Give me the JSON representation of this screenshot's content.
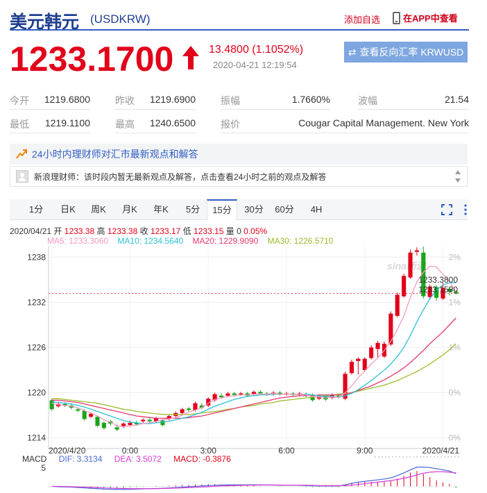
{
  "header": {
    "name": "美元韩元",
    "code": "(USDKRW)",
    "add_fav": "添加自选",
    "app_view": "在APP中查看"
  },
  "quote": {
    "price": "1233.1700",
    "change": "13.4800 (1.1052%)",
    "time": "2020-04-21 12:19:54",
    "reverse_label": "查看反向汇率 KRWUSD"
  },
  "stats": {
    "open_label": "今开",
    "open": "1219.6800",
    "prev_close_label": "昨收",
    "prev_close": "1219.6900",
    "amplitude_label": "振幅",
    "amplitude": "1.7660%",
    "wave_label": "波幅",
    "wave": "21.54",
    "low_label": "最低",
    "low": "1219.1100",
    "high_label": "最高",
    "high": "1240.6500",
    "quote_label": "报价",
    "quote": "Cougar Capital Management. New York"
  },
  "opinion": {
    "head": "24小时内理财师对汇市最新观点和解答",
    "body": "新浪理财师：该时段内暂无最新观点及解答，点击查看24小时之前的观点及解答"
  },
  "tabs": [
    "1分",
    "日K",
    "周K",
    "月K",
    "年K",
    "5分",
    "15分",
    "30分",
    "60分",
    "4H"
  ],
  "active_tab": "15分",
  "ohlc": {
    "date": "2020/04/21",
    "open_label": "开",
    "open": "1233.38",
    "high_label": "高",
    "high": "1233.38",
    "close_label": "收",
    "close": "1233.17",
    "low_label": "低",
    "low": "1233.15",
    "vol_label": "量",
    "vol": "0",
    "pct": "0.05%"
  },
  "ma": {
    "ma5": "MA5: 1233.3060",
    "ma10": "MA10: 1234.5640",
    "ma20": "MA20: 1229.9090",
    "ma30": "MA30: 1226.5710"
  },
  "macd": {
    "label": "MACD",
    "dif": "DIF: 3.3134",
    "dea": "DEA: 3.5072",
    "macd": "MACD: -0.3876",
    "axis_top": "5"
  },
  "colors": {
    "up": "#e2001a",
    "down": "#1aa51a",
    "ma5": "#f29ac0",
    "ma10": "#2ec0d8",
    "ma20": "#e8386d",
    "ma30": "#9cbd2a"
  },
  "chart_data": {
    "type": "candlestick",
    "y_ticks": [
      "1238",
      "1232",
      "1226",
      "1220",
      "1214"
    ],
    "y_tick_values": [
      1238,
      1232,
      1226,
      1220,
      1214
    ],
    "pct_ticks": [
      "2%",
      "1%",
      "1%",
      "0%",
      "0%"
    ],
    "ylim": [
      1213.5,
      1239.5
    ],
    "x_ticks": [
      "2020/4/20",
      "0:00",
      "3:00",
      "6:00",
      "9:00",
      "2020/4/21"
    ],
    "x_tick_index": [
      0,
      12,
      24,
      36,
      48,
      60
    ],
    "last_price_labels": [
      "1233.3800",
      "1233.1590"
    ],
    "watermark": "sina新浪",
    "candles": [
      {
        "o": 1219.0,
        "c": 1217.8,
        "h": 1219.2,
        "l": 1217.6
      },
      {
        "o": 1218.2,
        "c": 1218.5,
        "h": 1218.8,
        "l": 1218.0
      },
      {
        "o": 1218.5,
        "c": 1218.3,
        "h": 1218.7,
        "l": 1218.1
      },
      {
        "o": 1218.3,
        "c": 1218.0,
        "h": 1218.6,
        "l": 1217.8
      },
      {
        "o": 1217.8,
        "c": 1217.6,
        "h": 1218.0,
        "l": 1217.4
      },
      {
        "o": 1217.6,
        "c": 1216.5,
        "h": 1217.8,
        "l": 1216.3
      },
      {
        "o": 1216.8,
        "c": 1217.2,
        "h": 1217.4,
        "l": 1216.6
      },
      {
        "o": 1216.8,
        "c": 1215.6,
        "h": 1217.0,
        "l": 1215.4
      },
      {
        "o": 1216.0,
        "c": 1215.3,
        "h": 1216.2,
        "l": 1215.1
      },
      {
        "o": 1216.2,
        "c": 1215.9,
        "h": 1216.4,
        "l": 1215.6
      },
      {
        "o": 1215.4,
        "c": 1215.1,
        "h": 1215.8,
        "l": 1214.9
      },
      {
        "o": 1215.5,
        "c": 1215.9,
        "h": 1216.1,
        "l": 1215.3
      },
      {
        "o": 1215.7,
        "c": 1216.0,
        "h": 1216.3,
        "l": 1215.5
      },
      {
        "o": 1216.0,
        "c": 1215.8,
        "h": 1216.3,
        "l": 1215.6
      },
      {
        "o": 1216.2,
        "c": 1216.4,
        "h": 1216.6,
        "l": 1216.0
      },
      {
        "o": 1216.4,
        "c": 1216.2,
        "h": 1216.6,
        "l": 1216.0
      },
      {
        "o": 1216.2,
        "c": 1216.6,
        "h": 1216.8,
        "l": 1216.0
      },
      {
        "o": 1216.3,
        "c": 1215.7,
        "h": 1216.5,
        "l": 1215.5
      },
      {
        "o": 1216.5,
        "c": 1216.9,
        "h": 1217.1,
        "l": 1216.3
      },
      {
        "o": 1216.9,
        "c": 1217.3,
        "h": 1217.5,
        "l": 1216.7
      },
      {
        "o": 1217.3,
        "c": 1217.8,
        "h": 1218.0,
        "l": 1217.1
      },
      {
        "o": 1217.9,
        "c": 1217.7,
        "h": 1218.1,
        "l": 1217.5
      },
      {
        "o": 1217.7,
        "c": 1218.6,
        "h": 1218.8,
        "l": 1217.5
      },
      {
        "o": 1218.3,
        "c": 1218.0,
        "h": 1218.6,
        "l": 1217.8
      },
      {
        "o": 1218.3,
        "c": 1219.2,
        "h": 1219.4,
        "l": 1218.1
      },
      {
        "o": 1219.0,
        "c": 1219.8,
        "h": 1220.0,
        "l": 1218.8
      },
      {
        "o": 1219.6,
        "c": 1219.4,
        "h": 1219.9,
        "l": 1219.2
      },
      {
        "o": 1219.6,
        "c": 1219.9,
        "h": 1220.1,
        "l": 1219.4
      },
      {
        "o": 1219.9,
        "c": 1219.7,
        "h": 1220.1,
        "l": 1219.5
      },
      {
        "o": 1219.8,
        "c": 1219.9,
        "h": 1220.1,
        "l": 1219.6
      },
      {
        "o": 1219.9,
        "c": 1219.6,
        "h": 1220.1,
        "l": 1219.4
      },
      {
        "o": 1219.8,
        "c": 1220.1,
        "h": 1220.3,
        "l": 1219.6
      },
      {
        "o": 1220.1,
        "c": 1219.9,
        "h": 1220.3,
        "l": 1219.7
      },
      {
        "o": 1219.9,
        "c": 1219.8,
        "h": 1220.1,
        "l": 1219.6
      },
      {
        "o": 1219.8,
        "c": 1220.0,
        "h": 1220.2,
        "l": 1219.6
      },
      {
        "o": 1220.0,
        "c": 1219.8,
        "h": 1220.2,
        "l": 1219.6
      },
      {
        "o": 1219.8,
        "c": 1219.9,
        "h": 1220.1,
        "l": 1219.6
      },
      {
        "o": 1219.9,
        "c": 1219.7,
        "h": 1220.1,
        "l": 1219.5
      },
      {
        "o": 1219.7,
        "c": 1219.9,
        "h": 1220.1,
        "l": 1219.5
      },
      {
        "o": 1219.8,
        "c": 1219.6,
        "h": 1220.0,
        "l": 1219.4
      },
      {
        "o": 1219.7,
        "c": 1219.0,
        "h": 1219.9,
        "l": 1218.8
      },
      {
        "o": 1219.2,
        "c": 1219.6,
        "h": 1219.8,
        "l": 1219.0
      },
      {
        "o": 1219.5,
        "c": 1219.1,
        "h": 1219.7,
        "l": 1218.9
      },
      {
        "o": 1219.3,
        "c": 1219.7,
        "h": 1219.9,
        "l": 1219.1
      },
      {
        "o": 1219.6,
        "c": 1219.4,
        "h": 1219.8,
        "l": 1219.2
      },
      {
        "o": 1219.2,
        "c": 1222.5,
        "h": 1222.8,
        "l": 1219.0
      },
      {
        "o": 1222.6,
        "c": 1224.1,
        "h": 1224.4,
        "l": 1222.4
      },
      {
        "o": 1224.2,
        "c": 1224.5,
        "h": 1224.7,
        "l": 1222.4
      },
      {
        "o": 1223.0,
        "c": 1224.5,
        "h": 1224.7,
        "l": 1222.8
      },
      {
        "o": 1224.6,
        "c": 1226.0,
        "h": 1226.3,
        "l": 1224.4
      },
      {
        "o": 1225.8,
        "c": 1226.6,
        "h": 1226.9,
        "l": 1224.6
      },
      {
        "o": 1224.8,
        "c": 1226.5,
        "h": 1226.8,
        "l": 1224.6
      },
      {
        "o": 1226.4,
        "c": 1230.5,
        "h": 1230.8,
        "l": 1226.2
      },
      {
        "o": 1230.2,
        "c": 1233.0,
        "h": 1233.3,
        "l": 1230.0
      },
      {
        "o": 1232.8,
        "c": 1235.5,
        "h": 1235.8,
        "l": 1232.6
      },
      {
        "o": 1235.3,
        "c": 1238.6,
        "h": 1239.0,
        "l": 1235.1
      },
      {
        "o": 1238.7,
        "c": 1238.9,
        "h": 1239.3,
        "l": 1238.2
      },
      {
        "o": 1238.6,
        "c": 1232.8,
        "h": 1239.4,
        "l": 1232.5
      },
      {
        "o": 1232.7,
        "c": 1234.1,
        "h": 1234.4,
        "l": 1232.4
      },
      {
        "o": 1234.0,
        "c": 1232.6,
        "h": 1234.3,
        "l": 1232.2
      },
      {
        "o": 1232.5,
        "c": 1233.9,
        "h": 1234.6,
        "l": 1232.3
      },
      {
        "o": 1233.8,
        "c": 1233.4,
        "h": 1234.1,
        "l": 1232.9
      },
      {
        "o": 1233.4,
        "c": 1233.17,
        "h": 1233.6,
        "l": 1233.0
      }
    ],
    "ma5": [
      1218.6,
      1218.4,
      1218.3,
      1218.2,
      1218.0,
      1217.6,
      1217.3,
      1216.9,
      1216.4,
      1216.1,
      1215.6,
      1215.5,
      1215.6,
      1215.7,
      1215.9,
      1216.0,
      1216.2,
      1216.4,
      1216.5,
      1216.7,
      1217.0,
      1217.4,
      1217.7,
      1218.0,
      1218.6,
      1219.1,
      1219.3,
      1219.5,
      1219.6,
      1219.7,
      1219.7,
      1219.8,
      1219.8,
      1219.8,
      1219.9,
      1219.8,
      1219.8,
      1219.8,
      1219.8,
      1219.7,
      1219.5,
      1219.4,
      1219.3,
      1219.4,
      1219.4,
      1220.0,
      1220.9,
      1222.0,
      1222.9,
      1223.8,
      1224.6,
      1225.6,
      1226.8,
      1228.4,
      1230.2,
      1232.6,
      1234.7,
      1236.0,
      1236.8,
      1236.7,
      1235.7,
      1234.8,
      1233.3
    ],
    "ma10": [
      1218.8,
      1218.7,
      1218.6,
      1218.5,
      1218.3,
      1218.1,
      1217.8,
      1217.5,
      1217.2,
      1216.9,
      1216.6,
      1216.3,
      1216.1,
      1216.0,
      1215.9,
      1215.9,
      1216.0,
      1216.1,
      1216.2,
      1216.4,
      1216.6,
      1216.8,
      1217.1,
      1217.4,
      1217.8,
      1218.2,
      1218.5,
      1218.8,
      1219.1,
      1219.3,
      1219.5,
      1219.6,
      1219.7,
      1219.7,
      1219.8,
      1219.8,
      1219.8,
      1219.8,
      1219.8,
      1219.8,
      1219.7,
      1219.6,
      1219.5,
      1219.5,
      1219.4,
      1219.6,
      1219.9,
      1220.4,
      1221.0,
      1221.6,
      1222.3,
      1223.0,
      1223.8,
      1224.8,
      1226.0,
      1227.6,
      1229.4,
      1231.0,
      1232.5,
      1233.6,
      1234.3,
      1234.6,
      1234.6
    ],
    "ma20": [
      1219.0,
      1219.0,
      1218.9,
      1218.8,
      1218.7,
      1218.5,
      1218.3,
      1218.1,
      1217.9,
      1217.7,
      1217.5,
      1217.3,
      1217.1,
      1216.9,
      1216.8,
      1216.7,
      1216.6,
      1216.6,
      1216.6,
      1216.6,
      1216.6,
      1216.7,
      1216.8,
      1216.9,
      1217.1,
      1217.3,
      1217.5,
      1217.7,
      1217.9,
      1218.1,
      1218.3,
      1218.5,
      1218.7,
      1218.9,
      1219.1,
      1219.3,
      1219.4,
      1219.5,
      1219.6,
      1219.6,
      1219.6,
      1219.7,
      1219.7,
      1219.7,
      1219.7,
      1219.8,
      1220.0,
      1220.3,
      1220.6,
      1220.9,
      1221.3,
      1221.7,
      1222.2,
      1222.7,
      1223.3,
      1224.0,
      1224.8,
      1225.6,
      1226.5,
      1227.3,
      1228.1,
      1229.0,
      1229.9
    ],
    "ma30": [
      1219.2,
      1219.2,
      1219.1,
      1219.0,
      1218.9,
      1218.8,
      1218.7,
      1218.6,
      1218.4,
      1218.2,
      1218.0,
      1217.8,
      1217.7,
      1217.5,
      1217.4,
      1217.3,
      1217.2,
      1217.1,
      1217.1,
      1217.1,
      1217.1,
      1217.1,
      1217.2,
      1217.3,
      1217.4,
      1217.5,
      1217.6,
      1217.8,
      1217.9,
      1218.1,
      1218.2,
      1218.3,
      1218.5,
      1218.6,
      1218.7,
      1218.9,
      1219.0,
      1219.1,
      1219.2,
      1219.3,
      1219.4,
      1219.5,
      1219.6,
      1219.7,
      1219.8,
      1219.9,
      1220.0,
      1220.2,
      1220.4,
      1220.6,
      1220.8,
      1221.0,
      1221.3,
      1221.6,
      1222.0,
      1222.4,
      1222.8,
      1223.3,
      1223.8,
      1224.4,
      1225.0,
      1225.7,
      1226.5
    ],
    "macd_dif": [
      0.0,
      -0.1,
      -0.15,
      -0.2,
      -0.3,
      -0.4,
      -0.5,
      -0.6,
      -0.7,
      -0.75,
      -0.8,
      -0.8,
      -0.75,
      -0.7,
      -0.65,
      -0.6,
      -0.55,
      -0.5,
      -0.4,
      -0.3,
      -0.2,
      -0.1,
      0.0,
      0.1,
      0.2,
      0.3,
      0.35,
      0.4,
      0.4,
      0.4,
      0.4,
      0.4,
      0.4,
      0.35,
      0.35,
      0.3,
      0.3,
      0.3,
      0.25,
      0.2,
      0.15,
      0.1,
      0.1,
      0.1,
      0.1,
      0.4,
      0.8,
      1.1,
      1.3,
      1.5,
      1.7,
      1.9,
      2.2,
      2.8,
      3.5,
      4.3,
      5.0,
      5.0,
      4.9,
      4.6,
      4.3,
      4.0,
      3.3
    ],
    "macd_dea": [
      0.0,
      0.0,
      -0.05,
      -0.1,
      -0.15,
      -0.2,
      -0.25,
      -0.3,
      -0.4,
      -0.45,
      -0.5,
      -0.55,
      -0.6,
      -0.6,
      -0.6,
      -0.6,
      -0.6,
      -0.55,
      -0.5,
      -0.45,
      -0.4,
      -0.3,
      -0.25,
      -0.15,
      -0.1,
      0.0,
      0.1,
      0.15,
      0.2,
      0.25,
      0.3,
      0.3,
      0.35,
      0.35,
      0.35,
      0.35,
      0.3,
      0.3,
      0.3,
      0.3,
      0.25,
      0.2,
      0.2,
      0.2,
      0.2,
      0.2,
      0.3,
      0.5,
      0.7,
      0.9,
      1.1,
      1.3,
      1.5,
      1.8,
      2.1,
      2.5,
      3.0,
      3.4,
      3.7,
      3.8,
      3.8,
      3.7,
      3.5
    ]
  }
}
